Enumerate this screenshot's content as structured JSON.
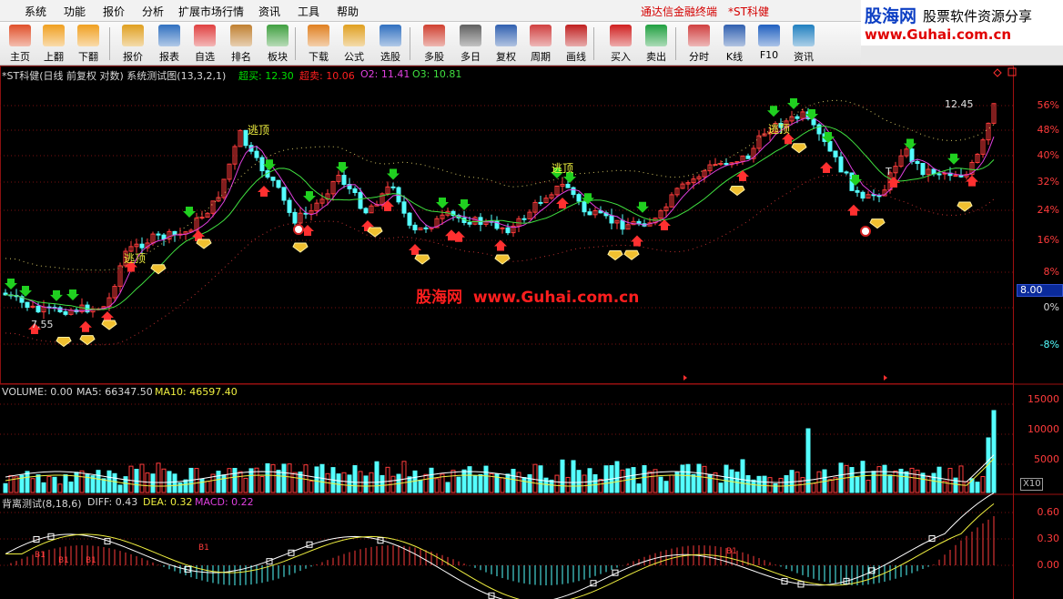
{
  "menu": {
    "items": [
      "系统",
      "功能",
      "报价",
      "分析",
      "扩展市场行情",
      "资讯",
      "工具",
      "帮助"
    ],
    "app_title": "通达信金融终端",
    "stock_title": "*ST科健"
  },
  "logo": {
    "line1_blue": "股海网",
    "line1_text": "股票软件资源分享",
    "line2": "www.Guhai.com.cn"
  },
  "toolbar": {
    "buttons": [
      {
        "label": "主页",
        "icon": "home-icon"
      },
      {
        "label": "上翻",
        "icon": "arrow-up-icon"
      },
      {
        "label": "下翻",
        "icon": "arrow-down-icon"
      },
      {
        "label": "报价",
        "icon": "yen-icon"
      },
      {
        "label": "报表",
        "icon": "report-icon"
      },
      {
        "label": "自选",
        "icon": "f6-icon"
      },
      {
        "label": "排名",
        "icon": "rank-icon"
      },
      {
        "label": "板块",
        "icon": "blocks-icon"
      },
      {
        "label": "下载",
        "icon": "download-icon"
      },
      {
        "label": "公式",
        "icon": "formula-icon"
      },
      {
        "label": "选股",
        "icon": "stock-pick-icon"
      },
      {
        "label": "多股",
        "icon": "multi-stock-icon"
      },
      {
        "label": "多日",
        "icon": "clock-icon"
      },
      {
        "label": "复权",
        "icon": "adjust-icon"
      },
      {
        "label": "周期",
        "icon": "f8-icon"
      },
      {
        "label": "画线",
        "icon": "draw-line-icon"
      },
      {
        "label": "买入",
        "icon": "buy-icon"
      },
      {
        "label": "卖出",
        "icon": "sell-icon"
      },
      {
        "label": "分时",
        "icon": "intraday-icon"
      },
      {
        "label": "K线",
        "icon": "kline-icon"
      },
      {
        "label": "F10",
        "icon": "f10-icon"
      },
      {
        "label": "资讯",
        "icon": "news-icon"
      }
    ]
  },
  "main_panel": {
    "title": "*ST科健(日线 前复权 对数) 系统测试图(13,3,2,1)",
    "indicators": [
      {
        "label": "超买: 12.30",
        "color": "#00e000"
      },
      {
        "label": "超卖: 10.06",
        "color": "#ff2020"
      },
      {
        "label": "O2: 11.41",
        "color": "#e040e0"
      },
      {
        "label": "O3: 10.81",
        "color": "#40e040"
      }
    ],
    "axis_labels": [
      "56%",
      "48%",
      "40%",
      "32%",
      "24%",
      "16%",
      "8%",
      "0%",
      "-8%"
    ],
    "current_value": "8.00",
    "high_label": "12.45",
    "low_label": "7.55",
    "escape_top_labels": [
      "逃顶",
      "逃顶",
      "逃顶",
      "逃顶"
    ],
    "watermark_cn": "股海网",
    "watermark_url": "www.Guhai.com.cn",
    "t_label": "T"
  },
  "volume_panel": {
    "title": "VOLUME: 0.00",
    "ma5": "MA5: 66347.50",
    "ma10": "MA10: 46597.40",
    "axis_labels": [
      "15000",
      "10000",
      "5000"
    ],
    "unit": "X10"
  },
  "macd_panel": {
    "title": "背离测试(8,18,6)",
    "diff": "DIFF: 0.43",
    "dea": "DEA: 0.32",
    "macd": "MACD: 0.22",
    "axis_labels": [
      "0.60",
      "0.30",
      "0.00"
    ],
    "markers": [
      "B1",
      "B1",
      "B1",
      "B1",
      "B1"
    ]
  },
  "colors": {
    "up": "#ff3b3b",
    "down": "#54ffff",
    "ma_short": "#e040e0",
    "ma_long": "#40e040",
    "band": "#d0c060"
  }
}
